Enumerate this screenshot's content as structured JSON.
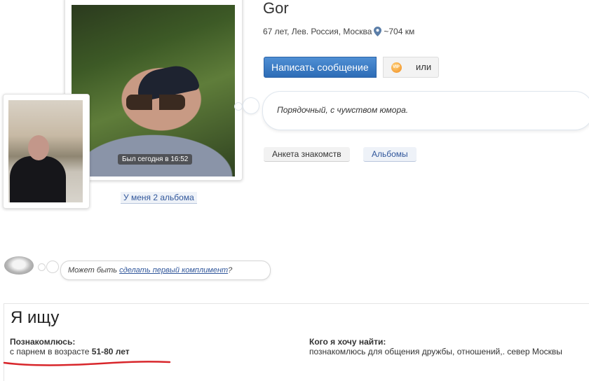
{
  "profile": {
    "name": "Gor",
    "meta": "67 лет, Лев. Россия, Москва",
    "distance": "~704 км",
    "last_seen": "Был сегодня в 16:52",
    "albums_link": "У меня 2 альбома",
    "status": "Порядочный, с чуwством юмора."
  },
  "actions": {
    "write_message": "Написать сообщение",
    "gift_icon_text": "VIP",
    "or": "или"
  },
  "tabs": {
    "anketa": "Анкета знакомств",
    "albums": "Альбомы"
  },
  "compliment": {
    "prefix": "Может быть ",
    "link": "сделать первый комплимент",
    "suffix": "?"
  },
  "seeking": {
    "title": "Я ищу",
    "meet_label": "Познакомлюсь:",
    "meet_value_prefix": "с парнем в возрасте ",
    "meet_age": "51-80 лет",
    "want_label": "Кого я хочу найти:",
    "want_value": "познакомлюсь для общения дружбы, отношений,. север Москвы"
  },
  "colors": {
    "accent": "#2d6cb6",
    "link": "#31579b",
    "underline": "#d8262b"
  },
  "icons": [
    "map-pin-icon",
    "gift-icon",
    "lips-icon"
  ]
}
